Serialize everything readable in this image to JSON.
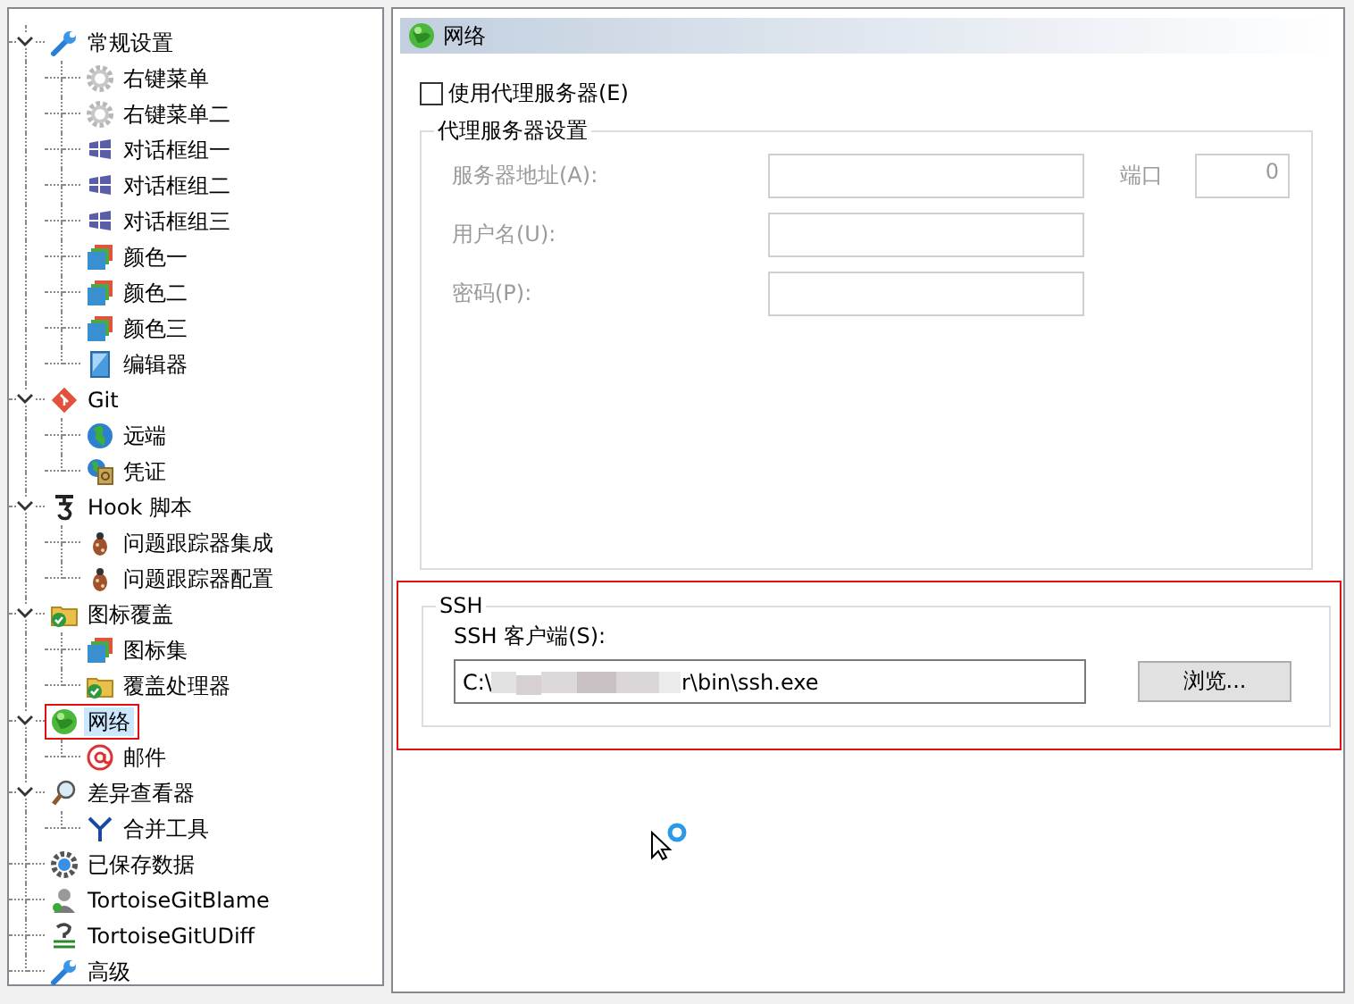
{
  "tree": {
    "items": [
      {
        "label": "常规设置",
        "kind": "wrench",
        "expanded": true,
        "selected": false,
        "annotated": false,
        "children": [
          {
            "label": "右键菜单",
            "kind": "gear",
            "selected": false,
            "annotated": false
          },
          {
            "label": "右键菜单二",
            "kind": "gear",
            "selected": false,
            "annotated": false
          },
          {
            "label": "对话框组一",
            "kind": "windows",
            "selected": false,
            "annotated": false
          },
          {
            "label": "对话框组二",
            "kind": "windows",
            "selected": false,
            "annotated": false
          },
          {
            "label": "对话框组三",
            "kind": "windows",
            "selected": false,
            "annotated": false
          },
          {
            "label": "颜色一",
            "kind": "colors",
            "selected": false,
            "annotated": false
          },
          {
            "label": "颜色二",
            "kind": "colors",
            "selected": false,
            "annotated": false
          },
          {
            "label": "颜色三",
            "kind": "colors",
            "selected": false,
            "annotated": false
          },
          {
            "label": "编辑器",
            "kind": "editor",
            "selected": false,
            "annotated": false
          }
        ]
      },
      {
        "label": "Git",
        "kind": "git",
        "expanded": true,
        "selected": false,
        "annotated": false,
        "children": [
          {
            "label": "远端",
            "kind": "globe",
            "selected": false,
            "annotated": false
          },
          {
            "label": "凭证",
            "kind": "credential",
            "selected": false,
            "annotated": false
          }
        ]
      },
      {
        "label": "Hook 脚本",
        "kind": "hook",
        "expanded": true,
        "selected": false,
        "annotated": false,
        "children": [
          {
            "label": "问题跟踪器集成",
            "kind": "bug",
            "selected": false,
            "annotated": false
          },
          {
            "label": "问题跟踪器配置",
            "kind": "bug",
            "selected": false,
            "annotated": false
          }
        ]
      },
      {
        "label": "图标覆盖",
        "kind": "overlay",
        "expanded": true,
        "selected": false,
        "annotated": false,
        "children": [
          {
            "label": "图标集",
            "kind": "colors",
            "selected": false,
            "annotated": false
          },
          {
            "label": "覆盖处理器",
            "kind": "overlay",
            "selected": false,
            "annotated": false
          }
        ]
      },
      {
        "label": "网络",
        "kind": "network",
        "expanded": true,
        "selected": true,
        "annotated": true,
        "children": [
          {
            "label": "邮件",
            "kind": "at",
            "selected": false,
            "annotated": false
          }
        ]
      },
      {
        "label": "差异查看器",
        "kind": "magnifier",
        "expanded": true,
        "selected": false,
        "annotated": false,
        "children": [
          {
            "label": "合并工具",
            "kind": "merge",
            "selected": false,
            "annotated": false
          }
        ]
      },
      {
        "label": "已保存数据",
        "kind": "saved",
        "selected": false,
        "annotated": false
      },
      {
        "label": "TortoiseGitBlame",
        "kind": "blame",
        "selected": false,
        "annotated": false
      },
      {
        "label": "TortoiseGitUDiff",
        "kind": "udiff",
        "selected": false,
        "annotated": false
      },
      {
        "label": "高级",
        "kind": "wrench",
        "selected": false,
        "annotated": false
      }
    ]
  },
  "panel": {
    "title": "网络"
  },
  "proxy": {
    "use_proxy": {
      "label": "使用代理服务器(E)",
      "checked": false
    },
    "group": {
      "title": "代理服务器设置",
      "enabled": false,
      "fields": [
        {
          "label": "服务器地址(A):"
        },
        {
          "label": "用户名(U):"
        },
        {
          "label": "密码(P):"
        }
      ],
      "port": {
        "label": "端口",
        "value": "0"
      }
    }
  },
  "ssh": {
    "title": "SSH",
    "annotated": true,
    "client_label": "SSH 客户端(S):",
    "value_start": "C:\\",
    "redacted": true,
    "value_end": "r\\bin\\ssh.exe",
    "browse_button": "浏览..."
  }
}
